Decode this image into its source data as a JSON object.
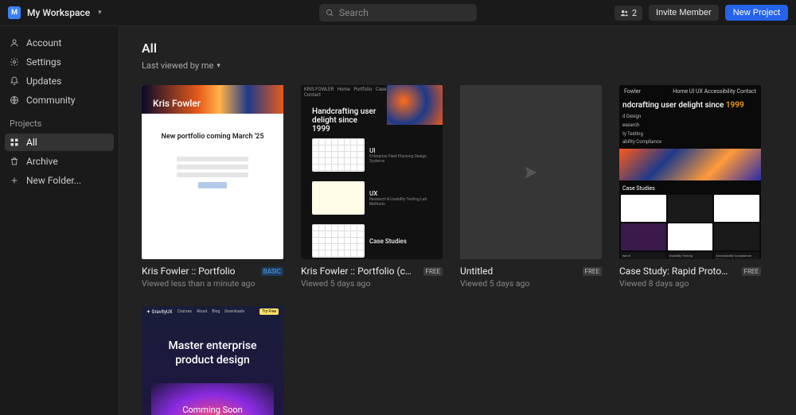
{
  "workspace": {
    "icon_letter": "M",
    "name": "My Workspace"
  },
  "search": {
    "placeholder": "Search"
  },
  "header": {
    "member_count": "2",
    "invite_label": "Invite Member",
    "new_project_label": "New Project"
  },
  "sidebar": {
    "top": [
      {
        "label": "Account",
        "icon": "user"
      },
      {
        "label": "Settings",
        "icon": "gear"
      },
      {
        "label": "Updates",
        "icon": "bell"
      },
      {
        "label": "Community",
        "icon": "globe"
      }
    ],
    "section_label": "Projects",
    "projects": [
      {
        "label": "All",
        "icon": "grid",
        "active": true
      },
      {
        "label": "Archive",
        "icon": "trash",
        "active": false
      },
      {
        "label": "New Folder...",
        "icon": "plus",
        "active": false
      }
    ]
  },
  "page": {
    "title": "All",
    "sort_label": "Last viewed by me"
  },
  "cards": [
    {
      "title": "Kris Fowler :: Portfolio",
      "subtitle": "Viewed less than a minute ago",
      "badge": "BASIC",
      "badge_type": "basic"
    },
    {
      "title": "Kris Fowler :: Portfolio (copy)",
      "subtitle": "Viewed 5 days ago",
      "badge": "FREE",
      "badge_type": "free"
    },
    {
      "title": "Untitled",
      "subtitle": "Viewed 5 days ago",
      "badge": "FREE",
      "badge_type": "free"
    },
    {
      "title": "Case Study: Rapid Prototyping",
      "subtitle": "Viewed 8 days ago",
      "badge": "FREE",
      "badge_type": "free"
    },
    {
      "title": "",
      "subtitle": "",
      "badge": "",
      "badge_type": ""
    }
  ],
  "thumbs": {
    "t1": {
      "author": "Kris Fowler",
      "msg": "New portfolio coming March '25"
    },
    "t2": {
      "headline": "Handcrafting user delight since 1999",
      "sections": [
        {
          "label": "UI",
          "sub": "Enterprise Fleet Planning Design Systems"
        },
        {
          "label": "UX",
          "sub": "Research & Usability Testing Lab Methods"
        },
        {
          "label": "Case Studies",
          "sub": ""
        }
      ]
    },
    "t4": {
      "brand": "Fowler",
      "nav": "Home   UI   UX   Accessibility   Contact",
      "headline_pre": "ndcrafting user delight since ",
      "headline_year": "1999",
      "bullets": [
        "d Design",
        "esearch",
        "ty Testing",
        "ability Compliance"
      ],
      "cs_label": "Case Studies",
      "bot_labels": [
        "earch",
        "Usability Testing",
        "Accessibility Compliance Strategy"
      ]
    },
    "t5": {
      "logo": "✦ GravityUX",
      "nav": [
        "Courses",
        "About",
        "Blog",
        "Downloads"
      ],
      "tag": "Try Free",
      "title": "Master enterprise product design",
      "soon": "Comming Soon"
    }
  }
}
